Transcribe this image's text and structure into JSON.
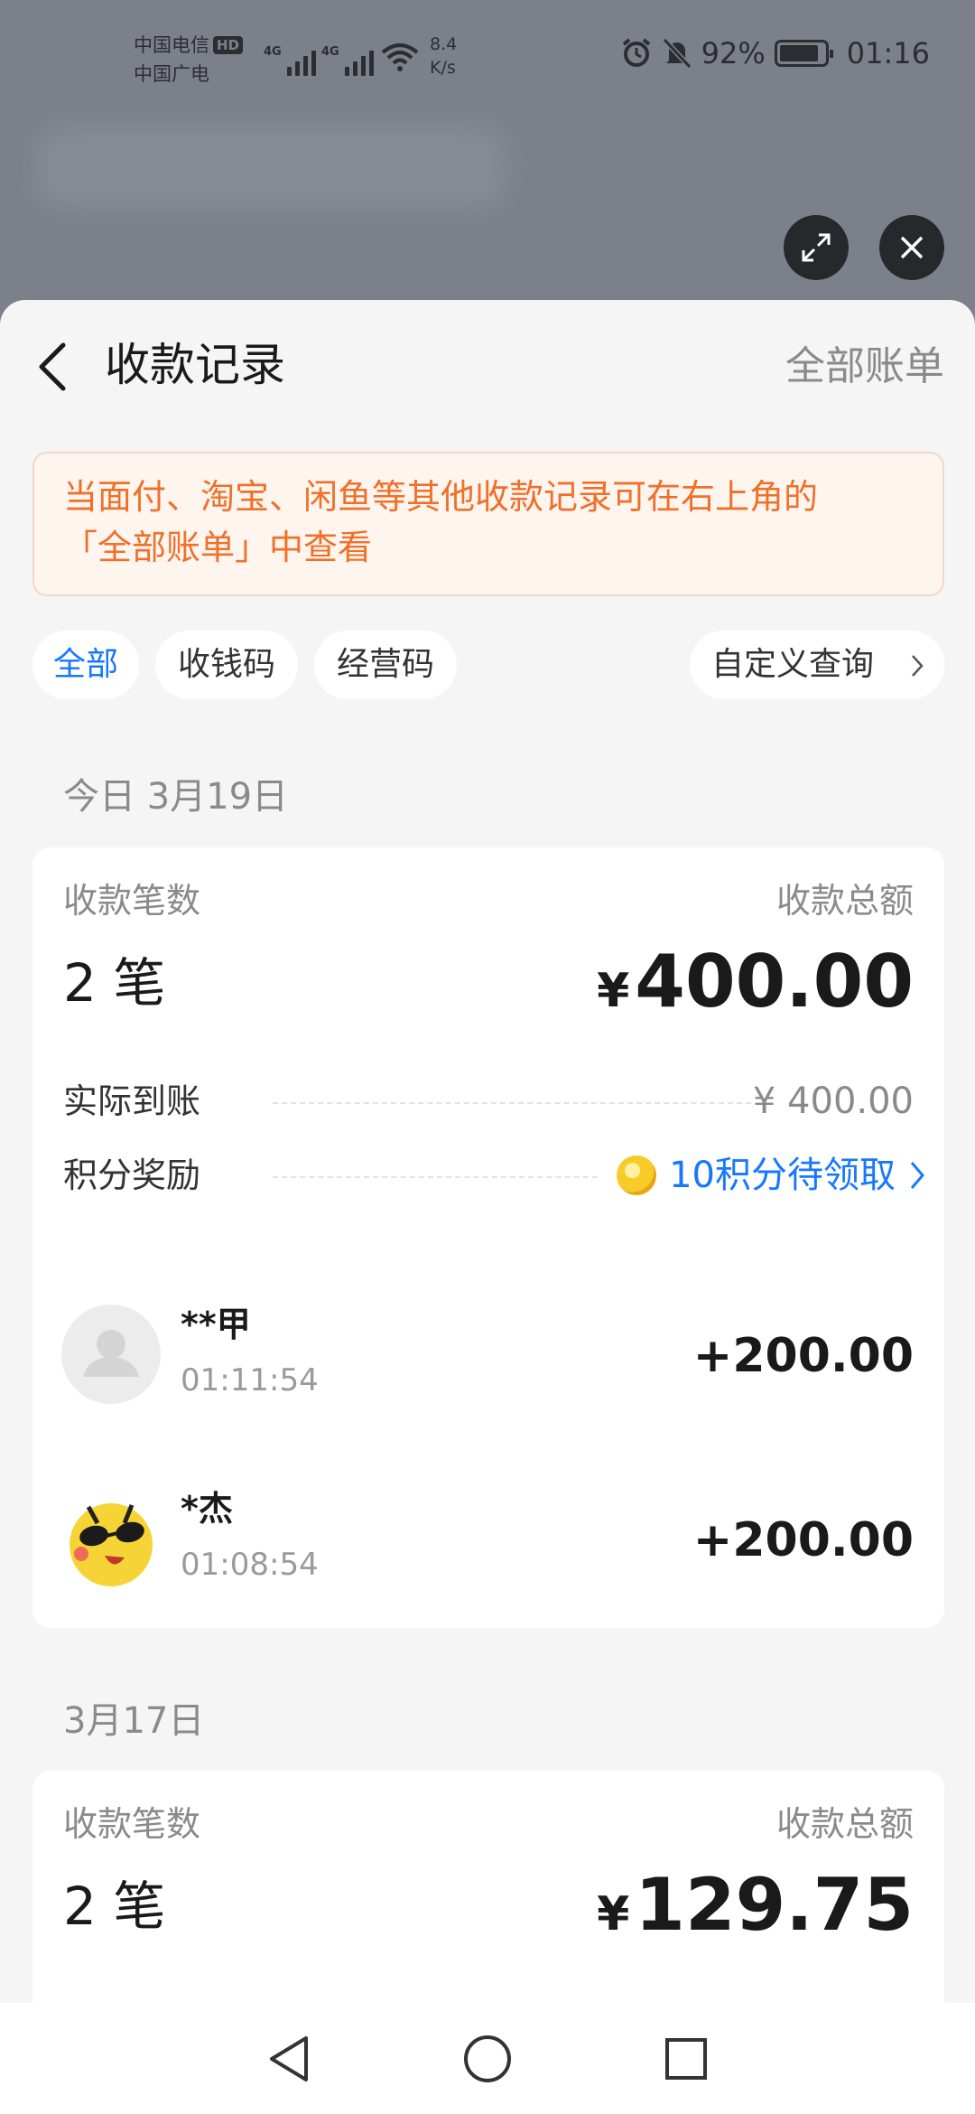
{
  "status_bar": {
    "carrier1": "中国电信",
    "hd_badge": "HD",
    "carrier2": "中国广电",
    "net1": "4G",
    "net2": "4G",
    "speed_value": "8.4",
    "speed_unit": "K/s",
    "battery": "92%",
    "time": "01:16"
  },
  "header": {
    "title": "收款记录",
    "all_bills": "全部账单"
  },
  "notice": {
    "line1": "当面付、淘宝、闲鱼等其他收款记录可在右上角的",
    "line2": "「全部账单」中查看"
  },
  "filters": {
    "items": [
      "全部",
      "收钱码",
      "经营码"
    ],
    "active_index": 0,
    "custom_query": "自定义查询"
  },
  "sections": [
    {
      "date": "今日 3月19日",
      "count_label": "收款笔数",
      "total_label": "收款总额",
      "count": "2 笔",
      "currency": "¥",
      "total": "400.00",
      "actual_label": "实际到账",
      "actual_value": "¥ 400.00",
      "points_label": "积分奖励",
      "points_value": "10积分待领取",
      "transactions": [
        {
          "name": "**甲",
          "time": "01:11:54",
          "amount": "+200.00"
        },
        {
          "name": "*杰",
          "time": "01:08:54",
          "amount": "+200.00"
        }
      ]
    },
    {
      "date": "3月17日",
      "count_label": "收款笔数",
      "total_label": "收款总额",
      "count": "2 笔",
      "currency": "¥",
      "total": "129.75"
    }
  ],
  "colors": {
    "accent": "#1677ff",
    "notice_text": "#f07029",
    "notice_bg": "#fff5ef",
    "sheet_bg": "#f5f5f5"
  }
}
